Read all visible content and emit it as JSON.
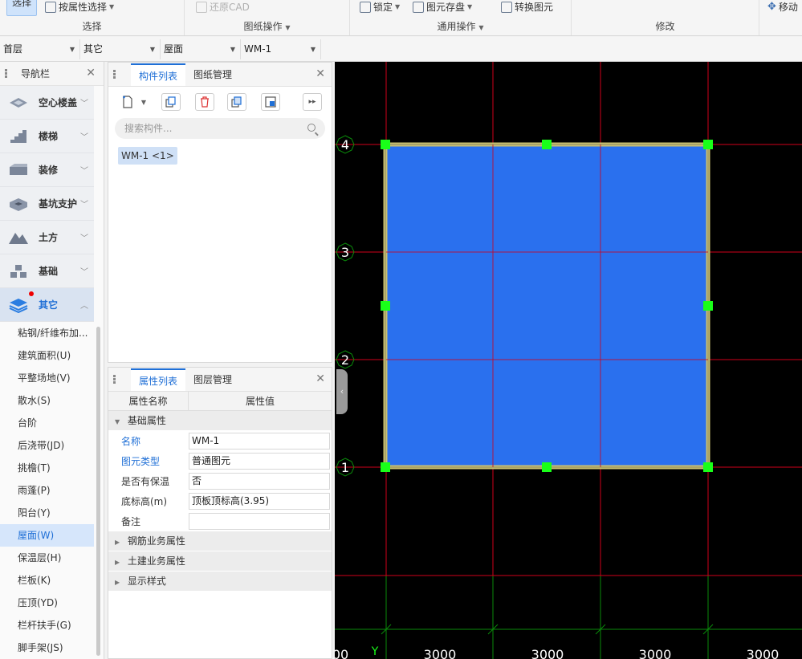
{
  "ribbon": {
    "select_label": "选择",
    "attr_select_label": "按属性选择",
    "restore_cad_label": "还原CAD",
    "lock_label": "锁定",
    "save_element_label": "图元存盘",
    "convert_element_label": "转换图元",
    "move_label": "移动",
    "groups": {
      "select": "选择",
      "drawing_ops": "图纸操作",
      "general_ops": "通用操作",
      "modify": "修改"
    }
  },
  "floorbar": {
    "floor": "首层",
    "category": "其它",
    "type": "屋面",
    "component": "WM-1"
  },
  "nav": {
    "title": "导航栏",
    "categories": [
      {
        "label": "空心楼盖",
        "icon": "hollow-floor-icon"
      },
      {
        "label": "楼梯",
        "icon": "stairs-icon"
      },
      {
        "label": "装修",
        "icon": "decoration-icon"
      },
      {
        "label": "基坑支护",
        "icon": "pit-support-icon"
      },
      {
        "label": "土方",
        "icon": "earthwork-icon"
      },
      {
        "label": "基础",
        "icon": "foundation-icon"
      },
      {
        "label": "其它",
        "icon": "layers-icon"
      }
    ],
    "subitems": [
      "粘钢/纤维布加...",
      "建筑面积(U)",
      "平整场地(V)",
      "散水(S)",
      "台阶",
      "后浇带(JD)",
      "挑檐(T)",
      "雨蓬(P)",
      "阳台(Y)",
      "屋面(W)",
      "保温层(H)",
      "栏板(K)",
      "压顶(YD)",
      "栏杆扶手(G)",
      "脚手架(JS)"
    ]
  },
  "comp_panel": {
    "tab_list": "构件列表",
    "tab_drawings": "图纸管理",
    "search_placeholder": "搜索构件...",
    "item": "WM-1 <1>"
  },
  "prop_panel": {
    "tab_props": "属性列表",
    "tab_layers": "图层管理",
    "col_name": "属性名称",
    "col_value": "属性值",
    "sec_basic": "基础属性",
    "rows": [
      {
        "name": "名称",
        "value": "WM-1"
      },
      {
        "name": "图元类型",
        "value": "普通图元"
      },
      {
        "name": "是否有保温",
        "value": "否"
      },
      {
        "name": "底标高(m)",
        "value": "顶板顶标高(3.95)"
      },
      {
        "name": "备注",
        "value": ""
      }
    ],
    "sec_rebar": "钢筋业务属性",
    "sec_civil": "土建业务属性",
    "sec_display": "显示样式"
  },
  "canvas": {
    "axis_labels": [
      "4",
      "3",
      "2",
      "1"
    ],
    "dims": [
      "00",
      "3000",
      "3000",
      "3000",
      "3000"
    ],
    "y_label": "Y",
    "colors": {
      "fill": "#2a70ee",
      "grid_red": "#d0001a",
      "grid_green": "#0a8a0a",
      "handle": "#19ff19",
      "border": "#c9c070"
    }
  }
}
